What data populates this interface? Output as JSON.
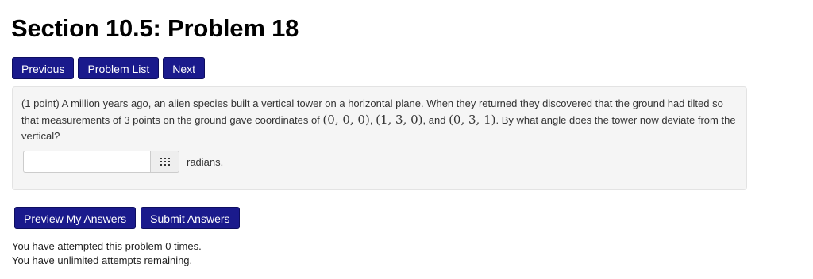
{
  "page": {
    "title": "Section 10.5: Problem 18"
  },
  "nav": {
    "previous_label": "Previous",
    "problem_list_label": "Problem List",
    "next_label": "Next"
  },
  "problem": {
    "points": "(1 point)",
    "text_part1": "A million years ago, an alien species built a vertical tower on a horizontal plane. When they returned they discovered that the ground had tilted so that measurements of 3 points on the ground gave coordinates of",
    "point1": "(0, 0, 0)",
    "sep1": ",",
    "point2": "(1, 3, 0)",
    "sep2": ", and",
    "point3": "(0, 3, 1)",
    "text_part2": ". By what angle does the tower now deviate from the vertical?",
    "answer_value": "",
    "answer_placeholder": "",
    "units": "radians."
  },
  "actions": {
    "preview_label": "Preview My Answers",
    "submit_label": "Submit Answers"
  },
  "status": {
    "attempted": "You have attempted this problem 0 times.",
    "remaining": "You have unlimited attempts remaining."
  },
  "colors": {
    "button_bg": "#1a1a8c",
    "panel_bg": "#f5f5f5"
  },
  "icons": {
    "keypad": "grid-keypad-icon"
  }
}
